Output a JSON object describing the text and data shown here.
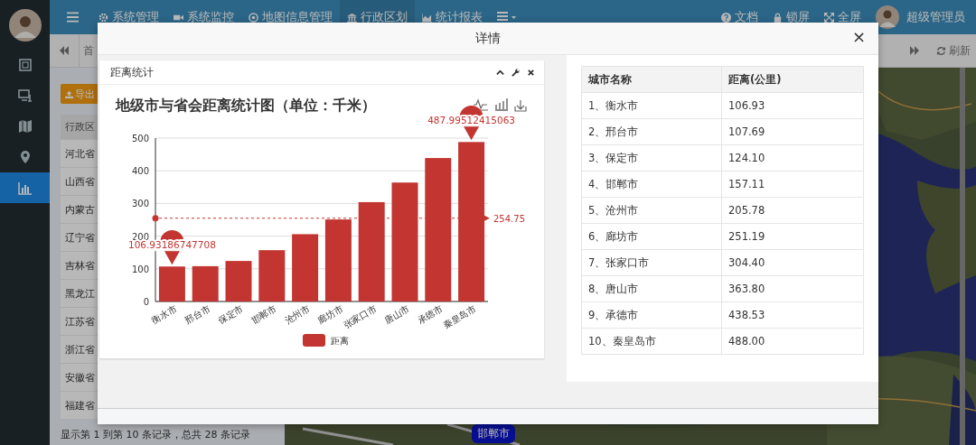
{
  "sidebar": {
    "items": [
      {
        "selected": false
      },
      {
        "selected": false
      },
      {
        "selected": false
      },
      {
        "selected": false
      },
      {
        "selected": true
      }
    ]
  },
  "topbar": {
    "menu": [
      {
        "label": "系统管理",
        "selected": false
      },
      {
        "label": "系统监控",
        "selected": false
      },
      {
        "label": "地图信息管理",
        "selected": false
      },
      {
        "label": "行政区划",
        "selected": true
      },
      {
        "label": "统计报表",
        "selected": false
      }
    ],
    "right": [
      {
        "label": "文档"
      },
      {
        "label": "锁屏"
      },
      {
        "label": "全屏"
      }
    ],
    "user": "超级管理员"
  },
  "tabbar": {
    "tab": "首",
    "refresh": "刷新"
  },
  "list_panel": {
    "export_button": "导出",
    "column": "行政区",
    "rows": [
      "河北省",
      "山西省",
      "内蒙古",
      "辽宁省",
      "吉林省",
      "黑龙江",
      "江苏省",
      "浙江省",
      "安徽省",
      "福建省"
    ],
    "footer": "显示第 1 到第 10 条记录，总共 28 条记录"
  },
  "map": {
    "marker": "邯郸市"
  },
  "modal": {
    "title": "详情",
    "close": "×",
    "chart_panel": {
      "title": "距离统计",
      "chart_data": {
        "type": "bar",
        "title": "地级市与省会距离统计图（单位：千米）",
        "categories": [
          "衡水市",
          "邢台市",
          "保定市",
          "邯郸市",
          "沧州市",
          "廊坊市",
          "张家口市",
          "唐山市",
          "承德市",
          "秦皇岛市"
        ],
        "series": [
          {
            "name": "距离",
            "color": "#c23531",
            "values": [
              107,
              108,
              124,
              157,
              206,
              251,
              304,
              364,
              439,
              488
            ]
          }
        ],
        "ylim": [
          0,
          500
        ],
        "yticks": [
          0,
          100,
          200,
          300,
          400,
          500
        ],
        "grid": true,
        "annotations": [
          {
            "x": "衡水市",
            "y": 107,
            "text": "106.93186747708"
          },
          {
            "x": "秦皇岛市",
            "y": 488,
            "text": "487.99512415063"
          }
        ],
        "ref_lines": [
          {
            "axis": "y",
            "value": 254.75,
            "label": "254.75"
          }
        ]
      }
    },
    "table": {
      "columns": [
        "城市名称",
        "距离(公里)"
      ],
      "rows": [
        [
          "1、衡水市",
          "106.93"
        ],
        [
          "2、邢台市",
          "107.69"
        ],
        [
          "3、保定市",
          "124.10"
        ],
        [
          "4、邯郸市",
          "157.11"
        ],
        [
          "5、沧州市",
          "205.78"
        ],
        [
          "6、廊坊市",
          "251.19"
        ],
        [
          "7、张家口市",
          "304.40"
        ],
        [
          "8、唐山市",
          "363.80"
        ],
        [
          "9、承德市",
          "438.53"
        ],
        [
          "10、秦皇岛市",
          "488.00"
        ]
      ]
    }
  }
}
